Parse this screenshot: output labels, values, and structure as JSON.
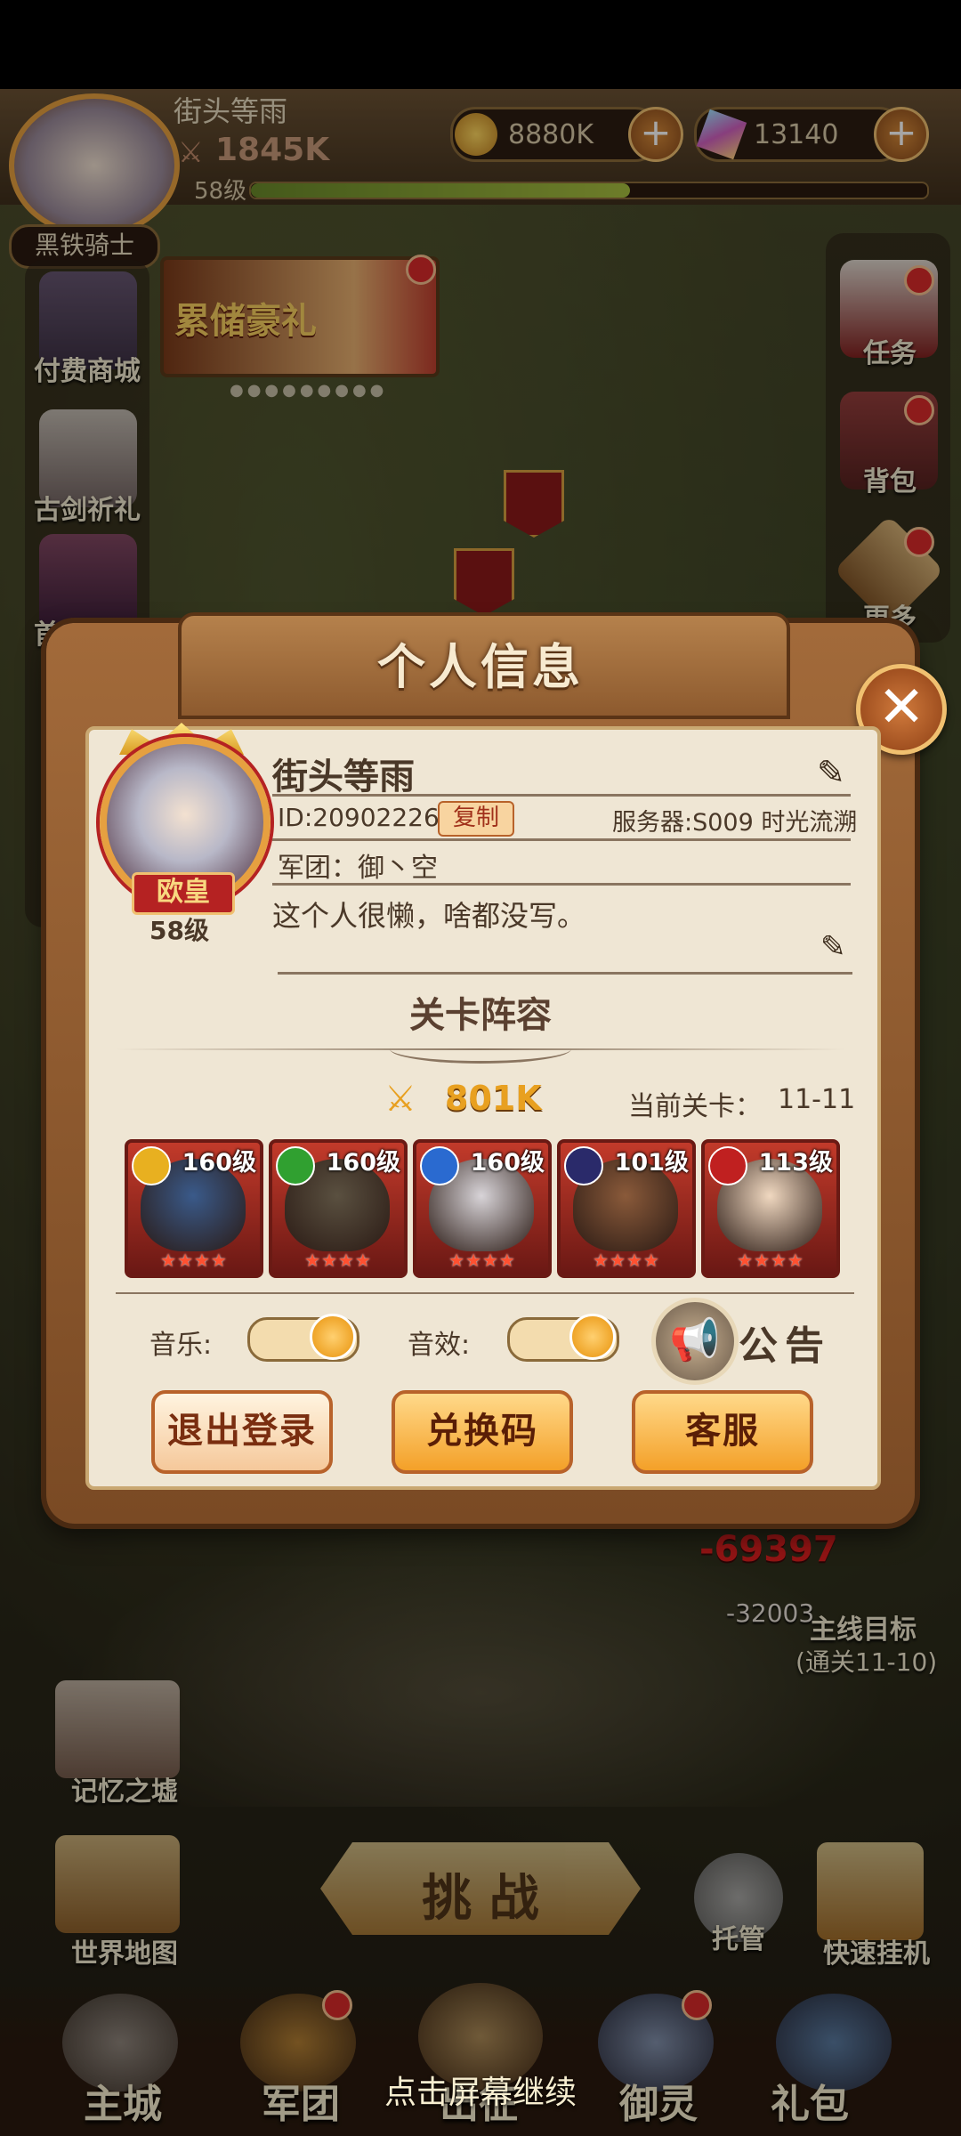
{
  "player": {
    "name": "街头等雨",
    "power": "1845K",
    "level_label": "58级",
    "title_badge": "黑铁骑士"
  },
  "currency": {
    "gold": "8880K",
    "gems": "13140"
  },
  "left_menu": [
    {
      "label": "付费商城"
    },
    {
      "label": "古剑祈礼"
    },
    {
      "label": "首充礼包"
    }
  ],
  "banner": {
    "label": "累储豪礼"
  },
  "right_menu": [
    {
      "label": "任务"
    },
    {
      "label": "背包"
    },
    {
      "label": "更多"
    }
  ],
  "modal": {
    "title": "个人信息",
    "name": "街头等雨",
    "id_text": "ID:20902226",
    "copy_label": "复制",
    "server_text": "服务器:S009 时光流溯",
    "guild_text": "军团：御丶空",
    "signature": "这个人很懒，啥都没写。",
    "avatar_rank": "欧皇",
    "avatar_level": "58级",
    "lineup_title": "关卡阵容",
    "lineup_power": "801K",
    "stage_label": "当前关卡：",
    "stage_value": "11-11",
    "heroes": [
      {
        "level": "160级",
        "elem_color": "#e8b020",
        "face_color": "#3a5a8a"
      },
      {
        "level": "160级",
        "elem_color": "#30a030",
        "face_color": "#5a5040"
      },
      {
        "level": "160级",
        "elem_color": "#2a6ad0",
        "face_color": "#d8d4d8"
      },
      {
        "level": "101级",
        "elem_color": "#2a2a6a",
        "face_color": "#8a5a3a"
      },
      {
        "level": "113级",
        "elem_color": "#c02020",
        "face_color": "#f0d8c0"
      }
    ],
    "music_label": "音乐:",
    "sfx_label": "音效:",
    "notice_label": "公告",
    "logout_label": "退出登录",
    "redeem_label": "兑换码",
    "service_label": "客服"
  },
  "battle": {
    "damage1": "-69397",
    "damage2": "-32003",
    "goal_title": "主线目标",
    "goal_sub": "(通关11-10)"
  },
  "bottom_actions": {
    "memory": "记忆之墟",
    "world_map": "世界地图",
    "challenge": "挑 战",
    "auto": "托管",
    "quick_idle": "快速挂机"
  },
  "bottom_nav": [
    {
      "label": "主城"
    },
    {
      "label": "军团"
    },
    {
      "label": "出征"
    },
    {
      "label": "御灵"
    },
    {
      "label": "礼包"
    }
  ],
  "continue_hint": "点击屏幕继续",
  "colors": {
    "accent": "#f4a028",
    "frame": "#8d5a2e",
    "panel": "#efe6d4"
  }
}
